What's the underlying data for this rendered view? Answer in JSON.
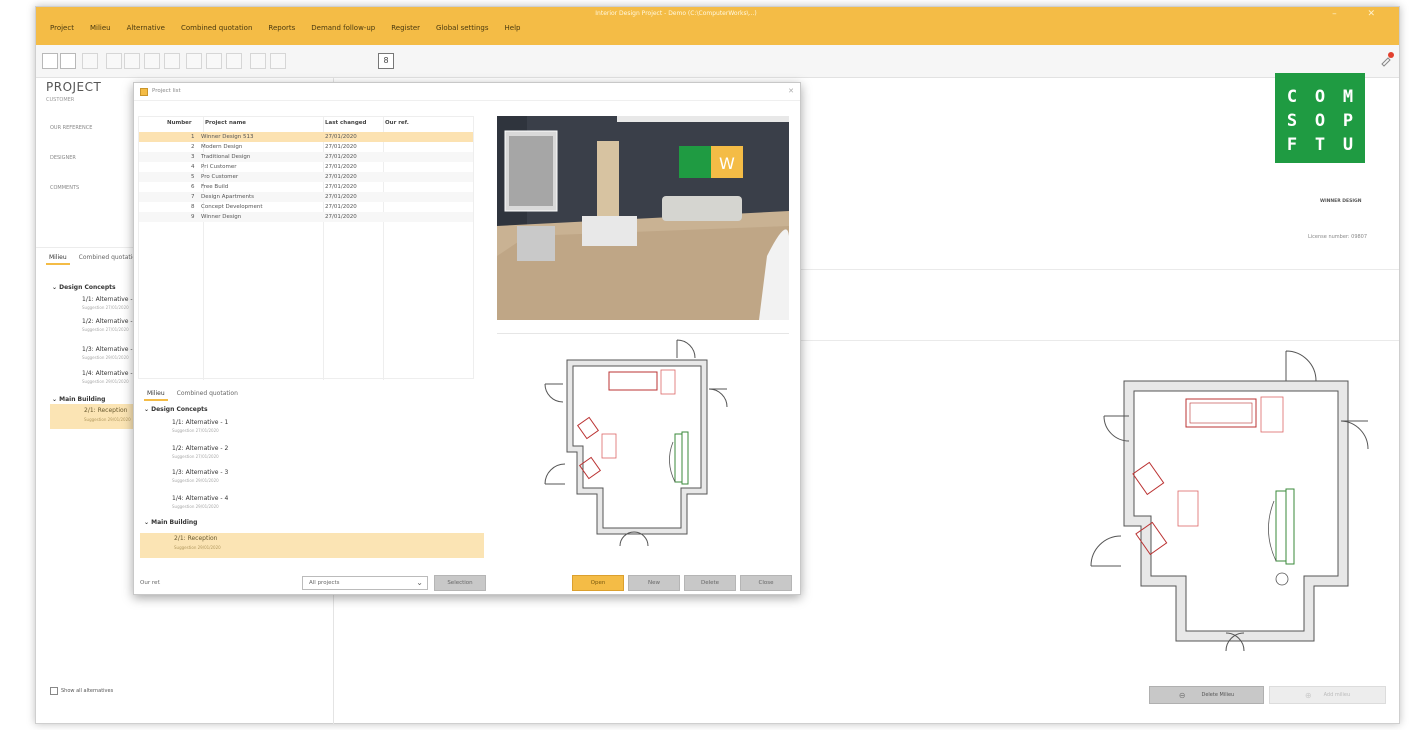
{
  "window": {
    "title": "Interior Design Project - Demo (C:\\ComputerWorks\\...)",
    "controls": "–  ✕"
  },
  "menu": [
    "Project",
    "Milieu",
    "Alternative",
    "Combined quotation",
    "Reports",
    "Demand follow-up",
    "Register",
    "Global settings",
    "Help"
  ],
  "header": {
    "title": "PROJECT",
    "subtitle": "CUSTOMER",
    "fields": [
      "OUR REFERENCE",
      "DESIGNER",
      "COMMENTS"
    ]
  },
  "left_tabs": [
    "Milieu",
    "Combined quotation"
  ],
  "left_tree": {
    "group1": "Design Concepts",
    "items": [
      {
        "label": "1/1: Alternative - 1",
        "sub": "Suggestion 27/01/2020"
      },
      {
        "label": "1/2: Alternative - 2",
        "sub": "Suggestion 27/01/2020"
      },
      {
        "label": "1/3: Alternative - 3",
        "sub": "Suggestion 29/01/2020"
      },
      {
        "label": "1/4: Alternative - 4",
        "sub": "Suggestion 29/01/2020"
      }
    ],
    "group2": "Main Building",
    "selected": {
      "label": "2/1: Reception",
      "sub": "Suggestion 29/01/2020"
    }
  },
  "show_all_alternatives": "Show all alternatives",
  "logo": {
    "letters": [
      "C",
      "O",
      "M",
      "S",
      "O",
      "P",
      "F",
      "T",
      "U"
    ],
    "caption": "WINNER DESIGN"
  },
  "license": "License number: 09807",
  "delete_buttons": {
    "primary": "Delete Milieu",
    "secondary": "Add milieu"
  },
  "dialog": {
    "title": "Project list",
    "columns": [
      "Number",
      "Project name",
      "Last changed",
      "Our ref."
    ],
    "projects": [
      {
        "num": "1",
        "name": "Winner Design 513",
        "date": "27/01/2020",
        "ref": ""
      },
      {
        "num": "2",
        "name": "Modern Design",
        "date": "27/01/2020",
        "ref": ""
      },
      {
        "num": "3",
        "name": "Traditional Design",
        "date": "27/01/2020",
        "ref": ""
      },
      {
        "num": "4",
        "name": "Pri Customer",
        "date": "27/01/2020",
        "ref": ""
      },
      {
        "num": "5",
        "name": "Pro Customer",
        "date": "27/01/2020",
        "ref": ""
      },
      {
        "num": "6",
        "name": "Free Build",
        "date": "27/01/2020",
        "ref": ""
      },
      {
        "num": "7",
        "name": "Design Apartments",
        "date": "27/01/2020",
        "ref": ""
      },
      {
        "num": "8",
        "name": "Concept Development",
        "date": "27/01/2020",
        "ref": ""
      },
      {
        "num": "9",
        "name": "Winner Design",
        "date": "27/01/2020",
        "ref": ""
      }
    ],
    "tabs": [
      "Milieu",
      "Combined quotation"
    ],
    "tree": {
      "group1": "Design Concepts",
      "items": [
        {
          "label": "1/1: Alternative - 1",
          "sub": "Suggestion 27/01/2020"
        },
        {
          "label": "1/2: Alternative - 2",
          "sub": "Suggestion 27/01/2020"
        },
        {
          "label": "1/3: Alternative - 3",
          "sub": "Suggestion 29/01/2020"
        },
        {
          "label": "1/4: Alternative - 4",
          "sub": "Suggestion 29/01/2020"
        }
      ],
      "group2": "Main Building",
      "selected": {
        "label": "2/1: Reception",
        "sub": "Suggestion 29/01/2020"
      }
    },
    "our_ref_label": "Our ref.",
    "filter_value": "All projects",
    "selection_button": "Selection",
    "buttons": [
      "Open",
      "New",
      "Delete",
      "Close"
    ],
    "render_sign": "W"
  },
  "colors": {
    "accent": "#f4bc46",
    "selection": "#fce2b1",
    "logo": "#1f9b42"
  }
}
